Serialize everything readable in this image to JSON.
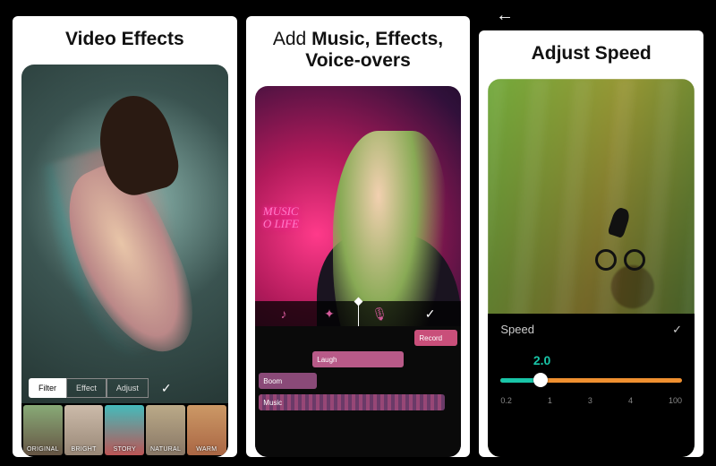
{
  "back_icon": "←",
  "panel1": {
    "heading": "Video Effects",
    "tabs": [
      "Filter",
      "Effect",
      "Adjust"
    ],
    "active_tab": "Filter",
    "confirm": "✓",
    "thumbs": [
      "ORIGINAL",
      "BRIGHT",
      "STORY",
      "NATURAL",
      "WARM"
    ]
  },
  "panel2": {
    "heading_light": "Add ",
    "heading_bold": "Music, Effects, Voice-overs",
    "neon_line1": "MUSIC",
    "neon_line2": "O LIFE",
    "toolbar": {
      "music": "♪",
      "effect": "✦",
      "voice": "🎙",
      "confirm": "✓"
    },
    "tracks": {
      "record": "Record",
      "laugh": "Laugh",
      "boom": "Boom",
      "music": "Music"
    }
  },
  "panel3": {
    "heading": "Adjust Speed",
    "label": "Speed",
    "confirm": "✓",
    "value": "2.0",
    "ticks": [
      "0.2",
      "1",
      "3",
      "4",
      "100"
    ]
  }
}
